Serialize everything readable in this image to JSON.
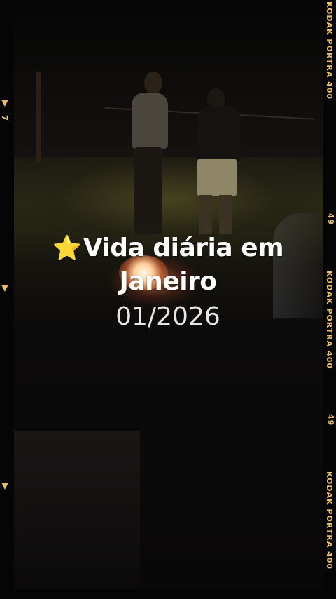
{
  "overlay": {
    "star_emoji": "⭐",
    "title_line1": "Vida diária em",
    "title_line2": "Janeiro",
    "date": "01/2026"
  },
  "film_strip": {
    "brand_label": "KODAK PORTRA 400",
    "frame_number_a": "49",
    "frame_number_b": "49",
    "left_frame_number": "7"
  },
  "colors": {
    "film_accent": "#e9c066",
    "title_text": "#ffffff",
    "date_text": "#e6e6e6"
  }
}
